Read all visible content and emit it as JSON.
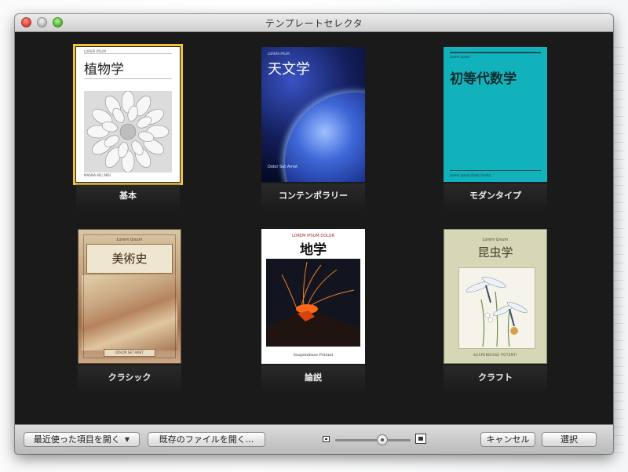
{
  "window": {
    "title": "テンプレートセレクタ"
  },
  "templates": [
    {
      "label": "基本",
      "selected": true,
      "cover": {
        "title": "植物学",
        "tiny": "LOREM IPSUM",
        "foot": "MAGNA AD | NISI"
      }
    },
    {
      "label": "コンテンポラリー",
      "selected": false,
      "cover": {
        "title": "天文学",
        "tiny": "LOREM IPSUM",
        "foot": "Dolor Set Amet"
      }
    },
    {
      "label": "モダンタイプ",
      "selected": false,
      "cover": {
        "title": "初等代数学",
        "tiny": "Lorem Ipsum",
        "foot": "Lorem Ipsum Dolor Facilisi"
      }
    },
    {
      "label": "クラシック",
      "selected": false,
      "cover": {
        "title": "美術史",
        "sub": "Lorem Ipsum",
        "foot": "DOLOR SET AMET"
      }
    },
    {
      "label": "論説",
      "selected": false,
      "cover": {
        "title": "地学",
        "sub": "LOREM IPSUM DOLOR",
        "foot": "Suspendisse Potenti"
      }
    },
    {
      "label": "クラフト",
      "selected": false,
      "cover": {
        "title": "昆虫学",
        "sub": "Lorem Ipsum",
        "foot": "SUSPENDISSE POTENTI"
      }
    }
  ],
  "bottombar": {
    "recent_label": "最近使った項目を開く",
    "open_existing_label": "既存のファイルを開く...",
    "cancel_label": "キャンセル",
    "choose_label": "選択",
    "zoom_level": 0.62
  },
  "colors": {
    "selection": "#f0c23a",
    "background": "#1a1a1a",
    "modern_cover": "#12b2bc"
  },
  "icons": [
    "close-icon",
    "minimize-icon",
    "zoom-icon",
    "chevron-down-icon",
    "small-image-icon",
    "large-image-icon"
  ]
}
